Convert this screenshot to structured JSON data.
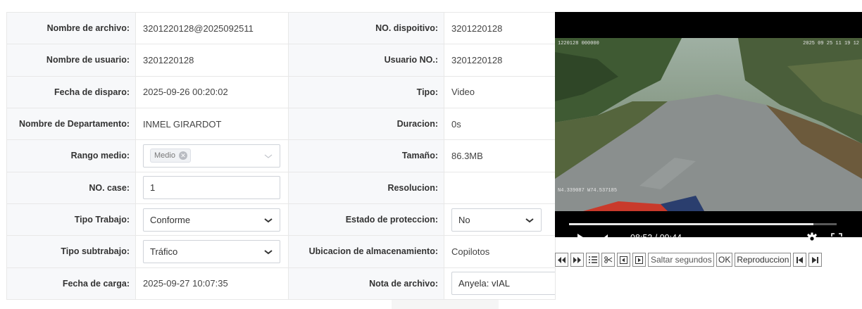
{
  "fields": {
    "file_name": {
      "label": "Nombre de archivo:",
      "value": "3201220128@2025092511"
    },
    "device_no": {
      "label": "NO. dispoitivo:",
      "value": "3201220128"
    },
    "user_name": {
      "label": "Nombre de usuario:",
      "value": "3201220128"
    },
    "user_no": {
      "label": "Usuario NO.:",
      "value": "3201220128"
    },
    "trigger_date": {
      "label": "Fecha de disparo:",
      "value": "2025-09-26 00:20:02"
    },
    "type": {
      "label": "Tipo:",
      "value": "Video"
    },
    "department": {
      "label": "Nombre de Departamento:",
      "value": "INMEL GIRARDOT"
    },
    "duration": {
      "label": "Duracion:",
      "value": "0s"
    },
    "medium_range": {
      "label": "Rango medio:",
      "tag": "Medio"
    },
    "size": {
      "label": "Tamaño:",
      "value": "86.3MB"
    },
    "case_no": {
      "label": "NO. case:",
      "value": "1"
    },
    "resolution": {
      "label": "Resolucion:",
      "value": ""
    },
    "work_type": {
      "label": "Tipo Trabajo:",
      "value": "Conforme"
    },
    "protection": {
      "label": "Estado de proteccion:",
      "value": "No"
    },
    "work_subtype": {
      "label": "Tipo subtrabajo:",
      "value": "Tráfico"
    },
    "storage": {
      "label": "Ubicacion de almacenamiento:",
      "value": "Copilotos"
    },
    "upload_date": {
      "label": "Fecha de carga:",
      "value": "2025-09-27 10:07:35"
    },
    "file_note": {
      "label": "Nota de archivo:",
      "value": "Anyela: vIAL"
    }
  },
  "video": {
    "overlay_device": "1220128 000000",
    "overlay_datetime": "2025 09 25 11 19 12",
    "overlay_gps": "N4.339087 W74.537185",
    "time": "08:53 / 09:44",
    "progress": 0.912
  },
  "toolbar": {
    "seek_placeholder": "Saltar segundos",
    "ok_label": "OK",
    "playback_label": "Reproduccion"
  }
}
